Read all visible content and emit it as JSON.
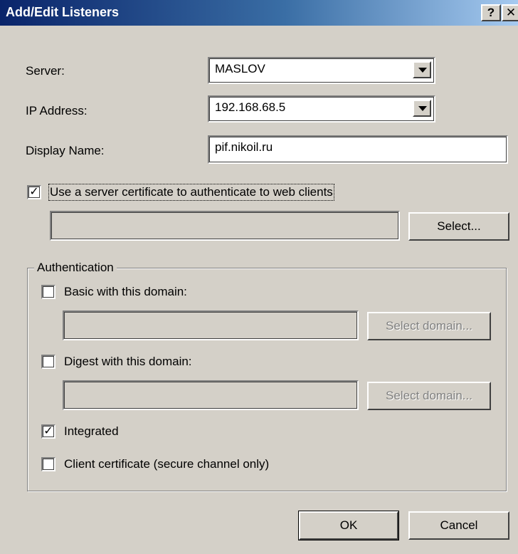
{
  "window": {
    "title": "Add/Edit Listeners",
    "help_button": "?",
    "close_button": "✕"
  },
  "server": {
    "label": "Server:",
    "value": "MASLOV"
  },
  "ip": {
    "label": "IP Address:",
    "value": "192.168.68.5"
  },
  "display_name": {
    "label": "Display Name:",
    "value": "pif.nikoil.ru"
  },
  "certificate": {
    "checkbox_label": "Use a server certificate to authenticate to web clients",
    "checked": true,
    "value": "",
    "select_button": "Select..."
  },
  "authentication": {
    "group_label": "Authentication",
    "basic": {
      "label": "Basic with this domain:",
      "checked": false,
      "value": "",
      "button": "Select domain..."
    },
    "digest": {
      "label": "Digest with this domain:",
      "checked": false,
      "value": "",
      "button": "Select domain..."
    },
    "integrated": {
      "label": "Integrated",
      "checked": true
    },
    "client_cert": {
      "label": "Client certificate (secure channel only)",
      "checked": false
    }
  },
  "buttons": {
    "ok": "OK",
    "cancel": "Cancel"
  },
  "check_mark": "✓"
}
